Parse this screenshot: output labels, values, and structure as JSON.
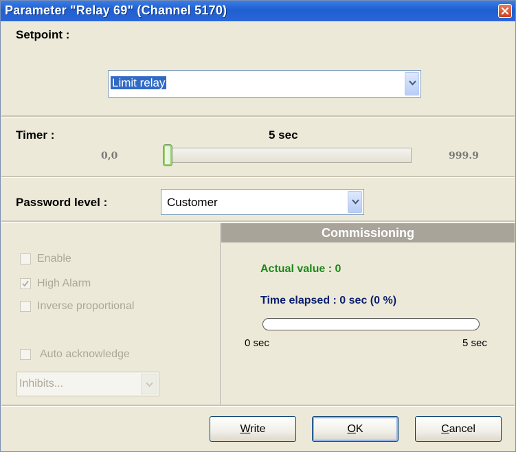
{
  "window": {
    "title": "Parameter \"Relay 69\" (Channel 5170)"
  },
  "setpoint": {
    "label": "Setpoint :",
    "value": "Limit relay"
  },
  "timer": {
    "label": "Timer :",
    "current": "5 sec",
    "min": "0,0",
    "max": "999.9",
    "slider_fraction": 0.005
  },
  "password": {
    "label": "Password level :",
    "value": "Customer"
  },
  "options": {
    "enable": {
      "label": "Enable",
      "checked": false
    },
    "high_alarm": {
      "label": "High Alarm",
      "checked": true
    },
    "inverse": {
      "label": "Inverse proportional",
      "checked": false
    },
    "auto_ack": {
      "label": "Auto acknowledge",
      "checked": false
    },
    "inhibits": {
      "value": "Inhibits..."
    }
  },
  "commissioning": {
    "header": "Commissioning",
    "actual_value": "Actual value : 0",
    "time_elapsed": "Time elapsed : 0 sec (0 %)",
    "progress_percent": 0,
    "start_label": "0 sec",
    "end_label": "5 sec"
  },
  "buttons": {
    "write": {
      "mnemonic": "W",
      "rest": "rite"
    },
    "ok": {
      "mnemonic": "O",
      "rest": "K"
    },
    "cancel": {
      "mnemonic": "C",
      "rest": "ancel"
    }
  },
  "colors": {
    "title_bar": "#2a67d9",
    "actual_value": "#1a8a1a",
    "time_elapsed": "#0a1f6e",
    "commission_header": "#a8a49a"
  }
}
